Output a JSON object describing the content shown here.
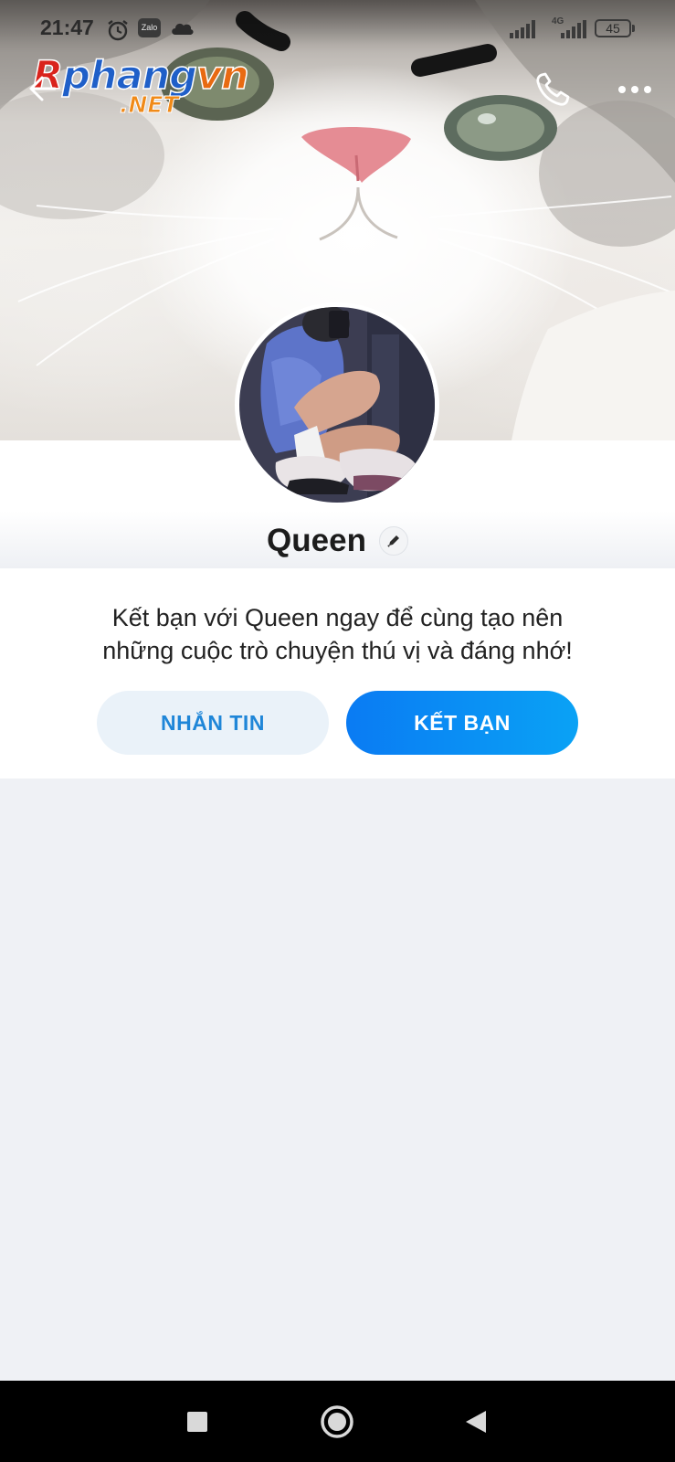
{
  "status_bar": {
    "time": "21:47",
    "app_badge": "Zalo",
    "network_type": "4G",
    "battery": "45"
  },
  "watermark": {
    "brand_r": "R",
    "brand_mid": "phang",
    "brand_vn": "vn",
    "domain": ".NET"
  },
  "header": {
    "back_icon": "back-arrow-icon",
    "call_icon": "phone-icon",
    "more_icon": "more-dots-icon"
  },
  "profile": {
    "name": "Queen",
    "edit_icon": "pencil-icon"
  },
  "card": {
    "intro_line1": "Kết bạn với Queen ngay để cùng tạo nên",
    "intro_line2": "những cuộc trò chuyện thú vị và đáng nhớ!",
    "message_button": "NHẮN TIN",
    "add_friend_button": "KẾT BẠN"
  },
  "colors": {
    "accent": "#0a8ef5",
    "secondary_button_bg": "#eaf2f9",
    "page_bg": "#eff1f5"
  },
  "nav": {
    "recents_icon": "square-icon",
    "home_icon": "circle-icon",
    "back_icon": "triangle-back-icon"
  }
}
